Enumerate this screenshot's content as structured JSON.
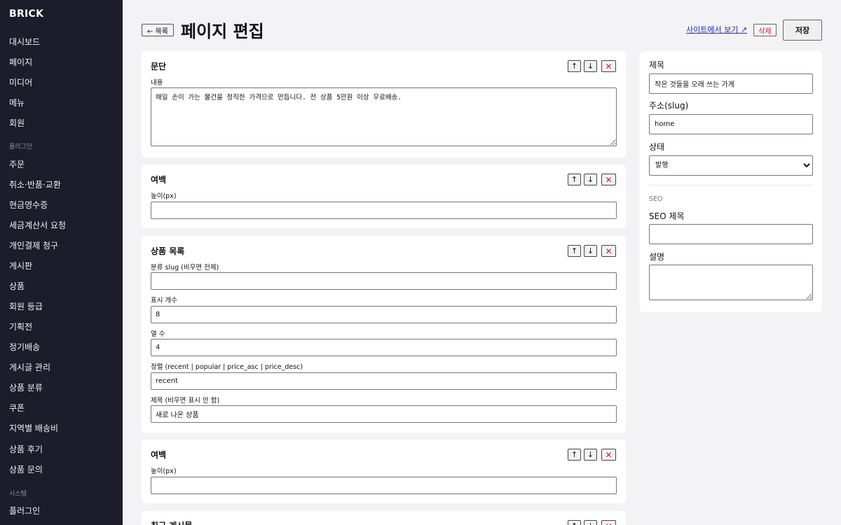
{
  "sidebar": {
    "brand": "BRICK",
    "items": [
      "대시보드",
      "페이지",
      "미디어",
      "메뉴",
      "회원"
    ],
    "plugin_section": "플러그인",
    "plugin_items": [
      "주문",
      "취소·반품·교환",
      "현금영수증",
      "세금계산서 요청",
      "개인결제 청구",
      "게시판",
      "상품",
      "회원 등급",
      "기획전",
      "정기배송",
      "게시글 관리",
      "상품 분류",
      "쿠폰",
      "지역별 배송비",
      "상품 후기",
      "상품 문의"
    ],
    "system_section": "시스템",
    "system_items": [
      "플러그인"
    ]
  },
  "header": {
    "back_label": "← 목록",
    "title": "페이지 편집",
    "site_link": "사이트에서 보기 ↗",
    "delete_label": "삭제",
    "save_label": "저장"
  },
  "controls": {
    "up": "↑",
    "down": "↓",
    "remove": "✕"
  },
  "blocks": [
    {
      "title": "문단",
      "fields": [
        {
          "label": "내용",
          "value": "매일 손이 가는 물건을 정직한 가격으로 만듭니다. 전 상품 5만원 이상 무료배송."
        }
      ]
    },
    {
      "title": "여백",
      "fields": [
        {
          "label": "높이(px)",
          "value": ""
        }
      ]
    },
    {
      "title": "상품 목록",
      "fields": [
        {
          "label": "분류 slug (비우면 전체)",
          "value": ""
        },
        {
          "label": "표시 개수",
          "value": "8"
        },
        {
          "label": "열 수",
          "value": "4"
        },
        {
          "label": "정렬 (recent | popular | price_asc | price_desc)",
          "value": "recent"
        },
        {
          "label": "제목 (비우면 표시 안 함)",
          "value": "새로 나온 상품"
        }
      ]
    },
    {
      "title": "여백",
      "fields": [
        {
          "label": "높이(px)",
          "value": ""
        }
      ]
    },
    {
      "title": "최근 게시물"
    }
  ],
  "settings": {
    "title_label": "제목",
    "title_value": "작은 것들을 오래 쓰는 가게",
    "slug_label": "주소(slug)",
    "slug_value": "home",
    "status_label": "상태",
    "status_value": "발행",
    "seo_section": "SEO",
    "seo_title_label": "SEO 제목",
    "seo_title_value": "",
    "description_label": "설명"
  }
}
